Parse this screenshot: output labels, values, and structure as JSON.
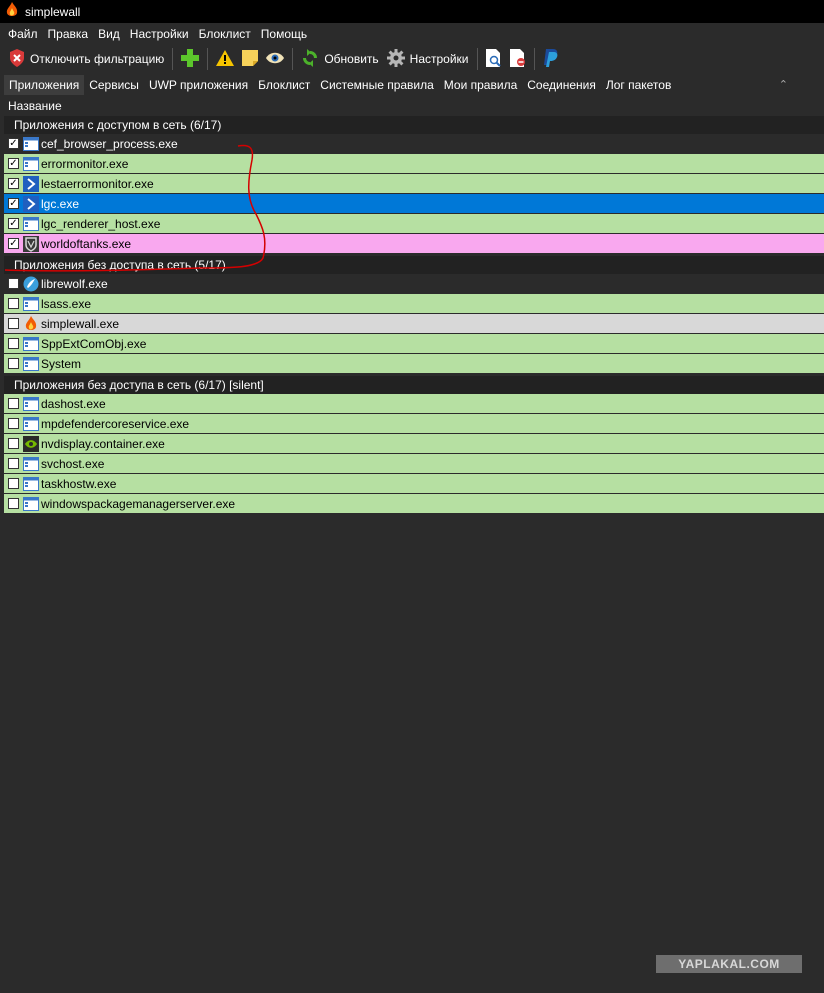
{
  "window": {
    "title": "simplewall"
  },
  "menu": [
    "Файл",
    "Правка",
    "Вид",
    "Настройки",
    "Блоклист",
    "Помощь"
  ],
  "toolbar": {
    "disable_filter": "Отключить фильтрацию",
    "refresh": "Обновить",
    "settings": "Настройки"
  },
  "tabs": [
    "Приложения",
    "Сервисы",
    "UWP приложения",
    "Блоклист",
    "Системные правила",
    "Мои правила",
    "Соединения",
    "Лог пакетов"
  ],
  "column_header": "Название",
  "groups": [
    {
      "title": "Приложения с доступом в сеть (6/17)",
      "items": [
        {
          "name": "cef_browser_process.exe",
          "checked": true,
          "color": "dark",
          "icon": "window-app-icon"
        },
        {
          "name": "errormonitor.exe",
          "checked": true,
          "color": "green",
          "icon": "window-app-icon"
        },
        {
          "name": "lestaerrormonitor.exe",
          "checked": true,
          "color": "green",
          "icon": "lesta-icon"
        },
        {
          "name": "lgc.exe",
          "checked": true,
          "color": "blue",
          "icon": "lesta-icon"
        },
        {
          "name": "lgc_renderer_host.exe",
          "checked": true,
          "color": "green",
          "icon": "window-app-icon"
        },
        {
          "name": "worldoftanks.exe",
          "checked": true,
          "color": "pink",
          "icon": "wot-icon"
        }
      ]
    },
    {
      "title": "Приложения без доступа в сеть (5/17)",
      "items": [
        {
          "name": "librewolf.exe",
          "checked": false,
          "color": "dark",
          "icon": "librewolf-icon"
        },
        {
          "name": "lsass.exe",
          "checked": false,
          "color": "green",
          "icon": "window-app-icon"
        },
        {
          "name": "simplewall.exe",
          "checked": false,
          "color": "grey",
          "icon": "flame-icon"
        },
        {
          "name": "SppExtComObj.exe",
          "checked": false,
          "color": "green",
          "icon": "window-app-icon"
        },
        {
          "name": "System",
          "checked": false,
          "color": "green",
          "icon": "window-app-icon"
        }
      ]
    },
    {
      "title": "Приложения без доступа в сеть (6/17) [silent]",
      "items": [
        {
          "name": "dashost.exe",
          "checked": false,
          "color": "green",
          "icon": "window-app-icon"
        },
        {
          "name": "mpdefendercoreservice.exe",
          "checked": false,
          "color": "green",
          "icon": "window-app-icon"
        },
        {
          "name": "nvdisplay.container.exe",
          "checked": false,
          "color": "green",
          "icon": "nvidia-icon"
        },
        {
          "name": "svchost.exe",
          "checked": false,
          "color": "green",
          "icon": "window-app-icon"
        },
        {
          "name": "taskhostw.exe",
          "checked": false,
          "color": "green",
          "icon": "window-app-icon"
        },
        {
          "name": "windowspackagemanagerserver.exe",
          "checked": false,
          "color": "green",
          "icon": "window-app-icon"
        }
      ]
    }
  ],
  "watermark": "YAPLAKAL.COM"
}
